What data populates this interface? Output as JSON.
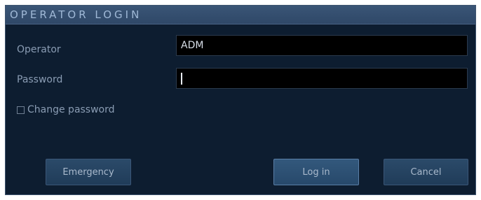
{
  "dialog": {
    "title": "OPERATOR LOGIN",
    "operator_label": "Operator",
    "operator_value": "ADM",
    "password_label": "Password",
    "password_value": "",
    "change_password_label": "Change password",
    "change_password_checked": false,
    "buttons": {
      "emergency": "Emergency",
      "login": "Log in",
      "cancel": "Cancel"
    }
  },
  "colors": {
    "dialog_bg": "#0d1d30",
    "titlebar_bg": "#3a5576",
    "field_bg": "#000000",
    "button_bg": "#2b4a69"
  }
}
